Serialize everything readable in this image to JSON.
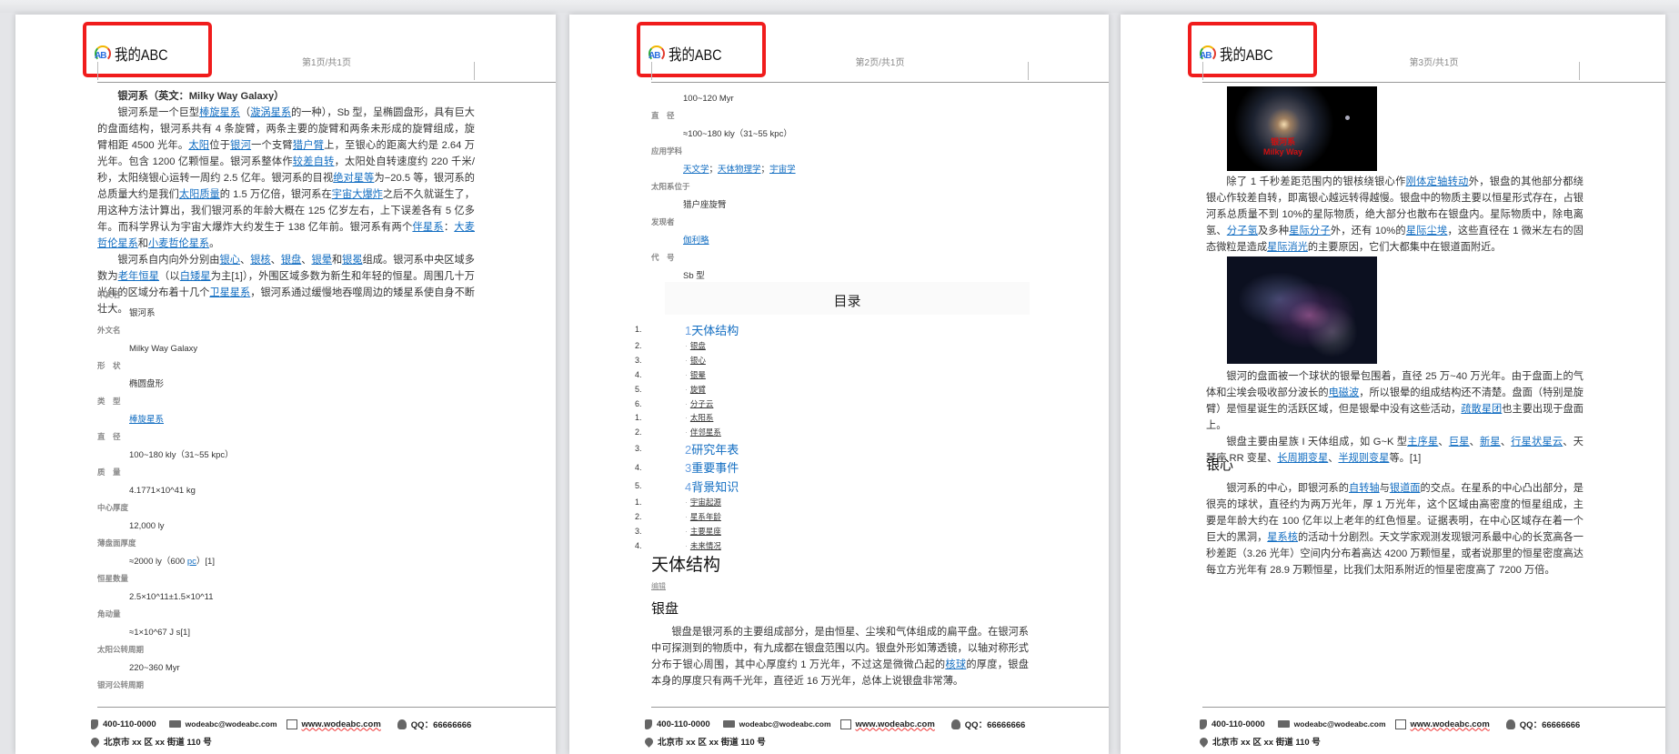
{
  "header": {
    "logo_text": "我的ABC",
    "pages": [
      "第1页/共1页",
      "第2页/共1页",
      "第3页/共1页"
    ]
  },
  "footer": {
    "phone": "400-110-0000",
    "email": "wodeabc@wodeabc.com",
    "web": "www.wodeabc.com",
    "qq": "QQ：66666666",
    "address": "北京市 xx 区 xx 街道 110 号"
  },
  "page1": {
    "title": "银河系（英文：Milky Way Galaxy）",
    "paragraphs": [
      [
        "银河系是一个巨型",
        {
          "link": "棒旋星系"
        },
        "（",
        {
          "link": "漩涡星系"
        },
        "的一种），Sb 型，呈椭圆盘形，具有巨大的盘面结构，银河系共有 4 条旋臂，两条主要的旋臂和两条未形成的旋臂组成，旋臂相距 4500 光年。",
        {
          "link": "太阳"
        },
        "位于",
        {
          "link": "银河"
        },
        "一个支臂",
        {
          "link": "猎户臂"
        },
        "上，至银心的距离大约是 2.64 万光年。包含 1200 亿颗恒星。银河系整体作",
        {
          "link": "较差自转"
        },
        "，太阳处自转速度约 220 千米/秒，太阳绕银心运转一周约 2.5 亿年。银河系的目视",
        {
          "link": "绝对星等"
        },
        "为−20.5 等，银河系的总质量大约是我们",
        {
          "link": "太阳质量"
        },
        "的 1.5 万亿倍，银河系在",
        {
          "link": "宇宙大爆炸"
        },
        "之后不久就诞生了，用这种方法计算出，我们银河系的年龄大概在 125 亿岁左右，上下误差各有 5 亿多年。而科学界认为宇宙大爆炸大约发生于 138 亿年前。银河系有两个",
        {
          "link": "伴星系"
        },
        "：",
        {
          "link": "大麦哲伦星系"
        },
        "和",
        {
          "link": "小麦哲伦星系"
        },
        "。"
      ],
      [
        "银河系自内向外分别由",
        {
          "link": "银心"
        },
        "、",
        {
          "link": "银核"
        },
        "、",
        {
          "link": "银盘"
        },
        "、",
        {
          "link": "银晕"
        },
        "和",
        {
          "link": "银冕"
        },
        "组成。银河系中央区域多数为",
        {
          "link": "老年恒星"
        },
        "（以",
        {
          "link": "白矮星"
        },
        "为主[1]），外围区域多数为新生和年轻的恒星。周围几十万光年的区域分布着十几个",
        {
          "link": "卫星星系"
        },
        "，银河系通过缓慢地吞噬周边的矮星系使自身不断壮大。"
      ]
    ],
    "info": [
      {
        "label": "中文名",
        "value": [
          "银河系"
        ]
      },
      {
        "label": "外文名",
        "value": [
          "Milky Way Galaxy"
        ]
      },
      {
        "label": "形　状",
        "value": [
          "椭圆盘形"
        ]
      },
      {
        "label": "类　型",
        "value": [
          {
            "link": "棒旋星系"
          }
        ]
      },
      {
        "label": "直　径",
        "value": [
          "100~180 kly（31~55 kpc）"
        ]
      },
      {
        "label": "质　量",
        "value": [
          "4.1771×10^41 kg"
        ]
      },
      {
        "label": "中心厚度",
        "value": [
          "12,000 ly"
        ]
      },
      {
        "label": "薄盘面厚度",
        "value": [
          "≈2000 ly（600 ",
          {
            "link": "pc"
          },
          "）[1]"
        ]
      },
      {
        "label": "恒星数量",
        "value": [
          "2.5×10^11±1.5×10^11"
        ]
      },
      {
        "label": "角动量",
        "value": [
          "≈1×10^67 J s[1]"
        ]
      },
      {
        "label": "太阳公转周期",
        "value": [
          "220~360 Myr"
        ]
      },
      {
        "label": "银河公转周期",
        "value": []
      }
    ]
  },
  "page2": {
    "info": [
      {
        "label": "",
        "value": [
          "100~120 Myr"
        ]
      },
      {
        "label": "直　径",
        "value": [
          "≈100~180 kly（31~55 kpc）"
        ]
      },
      {
        "label": "应用学科",
        "value": [
          {
            "link": "天文学"
          },
          "；",
          {
            "link": "天体物理学"
          },
          "；",
          {
            "link": "宇宙学"
          }
        ]
      },
      {
        "label": "太阳系位于",
        "value": [
          "猎户座旋臂"
        ]
      },
      {
        "label": "发现者",
        "value": [
          {
            "link": "伽利略"
          }
        ]
      },
      {
        "label": "代　号",
        "value": [
          "Sb 型"
        ]
      }
    ],
    "toc_title": "目录",
    "toc": [
      {
        "num": "1.",
        "pre": "1",
        "label": "天体结构",
        "level": 1
      },
      {
        "num": "2.",
        "pre": "·",
        "label": "银盘",
        "level": 2
      },
      {
        "num": "3.",
        "pre": "·",
        "label": "银心",
        "level": 2
      },
      {
        "num": "4.",
        "pre": "·",
        "label": "银晕",
        "level": 2
      },
      {
        "num": "5.",
        "pre": "·",
        "label": "旋臂",
        "level": 2
      },
      {
        "num": "6.",
        "pre": "·",
        "label": "分子云",
        "level": 2
      },
      {
        "num": "1.",
        "pre": "·",
        "label": "太阳系",
        "level": 2
      },
      {
        "num": "2.",
        "pre": "·",
        "label": "伴邻星系",
        "level": 2
      },
      {
        "num": "3.",
        "pre": "2",
        "label": "研究年表",
        "level": 1
      },
      {
        "num": "4.",
        "pre": "3",
        "label": "重要事件",
        "level": 1
      },
      {
        "num": "5.",
        "pre": "4",
        "label": "背景知识",
        "level": 1
      },
      {
        "num": "1.",
        "pre": "·",
        "label": "宇宙起源",
        "level": 2
      },
      {
        "num": "2.",
        "pre": "·",
        "label": "星系年龄",
        "level": 2
      },
      {
        "num": "3.",
        "pre": "·",
        "label": "主要星座",
        "level": 2
      },
      {
        "num": "4.",
        "pre": "·",
        "label": "未来情况",
        "level": 2
      }
    ],
    "section_title": "天体结构",
    "edit_label": "编辑",
    "sub_title": "银盘",
    "paragraph": [
      "银盘是银河系的主要组成部分，是由恒星、尘埃和气体组成的扁平盘。在银河系中可探测到的物质中，有九成都在银盘范围以内。银盘外形如薄透镜，以轴对称形式分布于银心周围，其中心厚度约 1 万光年，不过这是微微凸起的",
      {
        "link": "核球"
      },
      "的厚度，银盘本身的厚度只有两千光年，直径近 16 万光年，总体上说银盘非常薄。"
    ]
  },
  "page3": {
    "image_caption_cn": "银河系",
    "image_caption_en": "Milky Way",
    "paragraphs": [
      [
        "除了 1 千秒差距范围内的银核绕银心作",
        {
          "link": "刚体定轴转动"
        },
        "外，银盘的其他部分都绕银心作较差自转，即离银心越远转得越慢。银盘中的物质主要以恒星形式存在，占银河系总质量不到 10%的星际物质，绝大部分也散布在银盘内。星际物质中，除电离氢、",
        {
          "link": "分子氢"
        },
        "及多种",
        {
          "link": "星际分子"
        },
        "外，还有 10%的",
        {
          "link": "星际尘埃"
        },
        "，这些直径在 1 微米左右的固态微粒是造成",
        {
          "link": "星际消光"
        },
        "的主要原因，它们大都集中在银道面附近。"
      ]
    ],
    "paragraphs2": [
      [
        "银河的盘面被一个球状的银晕包围着，直径 25 万~40 万光年。由于盘面上的气体和尘埃会吸收部分波长的",
        {
          "link": "电磁波"
        },
        "，所以银晕的组成结构还不清楚。盘面（特别是旋臂）是恒星诞生的活跃区域，但是银晕中没有这些活动，",
        {
          "link": "疏散星团"
        },
        "也主要出现于盘面上。"
      ],
      [
        "银盘主要由星族 I 天体组成，如 G~K 型",
        {
          "link": "主序星"
        },
        "、",
        {
          "link": "巨星"
        },
        "、",
        {
          "link": "新星"
        },
        "、",
        {
          "link": "行星状星云"
        },
        "、天琴座 RR 变星、",
        {
          "link": "长周期变星"
        },
        "、",
        {
          "link": "半规则变星"
        },
        "等。[1]"
      ]
    ],
    "section_title": "银心",
    "paragraphs3": [
      [
        "银河系的中心，即银河系的",
        {
          "link": "自转轴"
        },
        "与",
        {
          "link": "银道面"
        },
        "的交点。在星系的中心凸出部分，是很亮的球状，直径约为两万光年，厚 1 万光年，这个区域由高密度的恒星组成，主要是年龄大约在 100 亿年以上老年的红色恒星。证据表明，在中心区域存在着一个巨大的黑洞，",
        {
          "link": "星系核"
        },
        "的活动十分剧烈。天文学家观测发现银河系最中心的长宽高各一秒差距（3.26 光年）空间内分布着高达 4200 万颗恒星，或者说那里的恒星密度高达每立方光年有 28.9 万颗恒星，比我们太阳系附近的恒星密度高了 7200 万倍。"
      ]
    ]
  },
  "colors": {
    "link": "#136ec2",
    "highlight_box": "#f01c1c"
  }
}
